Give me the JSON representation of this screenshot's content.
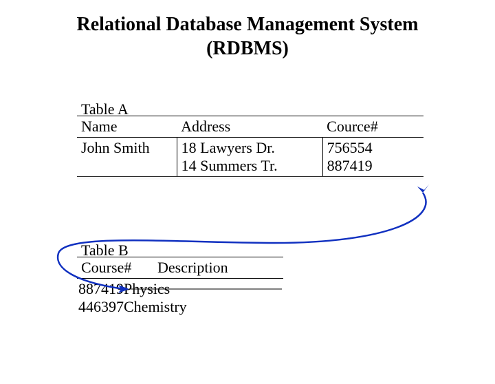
{
  "title_line1": "Relational Database Management System",
  "title_line2": "(RDBMS)",
  "tableA": {
    "label": "Table A",
    "headers": {
      "name": "Name",
      "address": "Address",
      "course": "Cource#"
    },
    "row": {
      "name": "John Smith",
      "address_line1": "18 Lawyers Dr.",
      "address_line2": "14 Summers Tr.",
      "course_line1": "756554",
      "course_line2": "887419"
    }
  },
  "tableB": {
    "label": "Table B",
    "headers": {
      "course": "Course#",
      "desc": "Description"
    },
    "rows": [
      {
        "course": "887419",
        "desc": "Physics"
      },
      {
        "course": "446397",
        "desc": "Chemistry"
      }
    ]
  }
}
